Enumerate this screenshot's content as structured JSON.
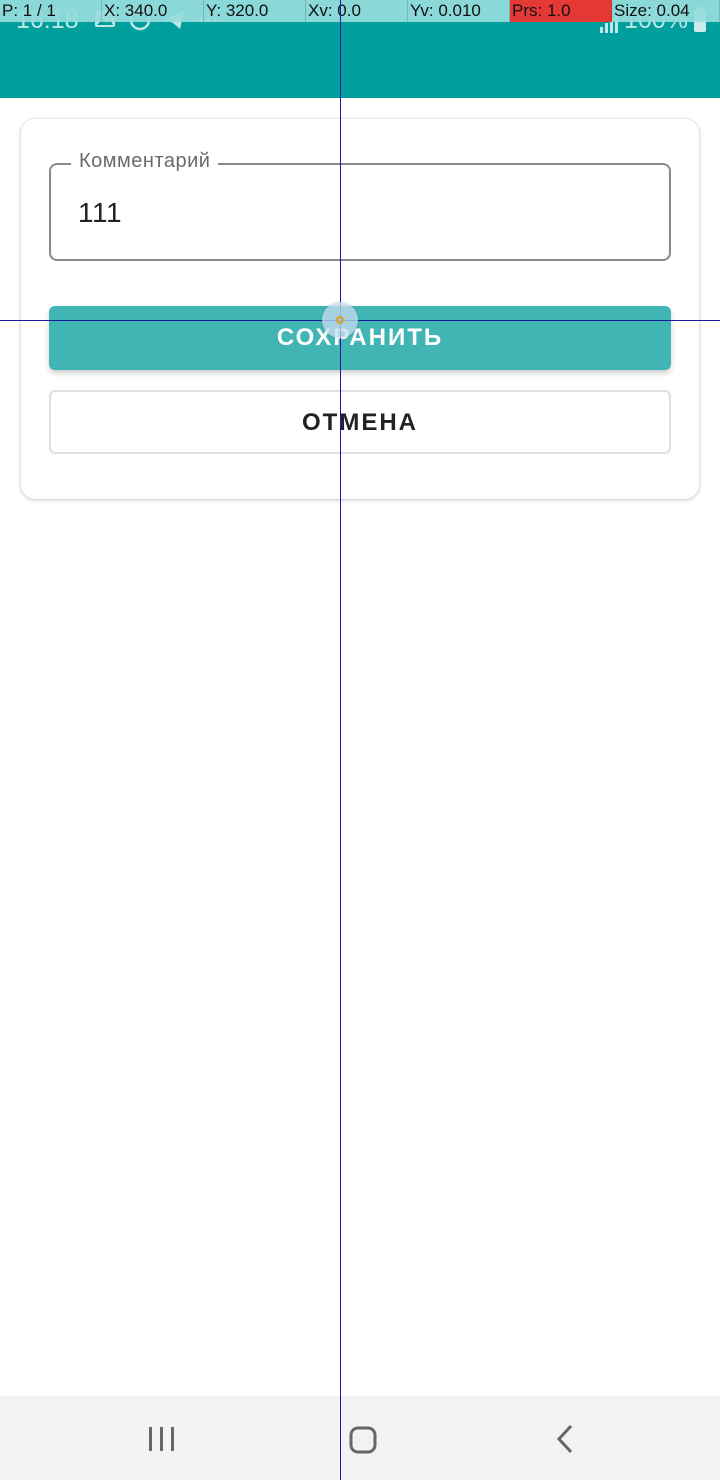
{
  "debug_overlay": {
    "pointer": "P: 1 / 1",
    "x": "X: 340.0",
    "y": "Y: 320.0",
    "xv": "Xv: 0.0",
    "yv": "Yv: 0.010",
    "prs": "Prs: 1.0",
    "size": "Size: 0.04"
  },
  "status_bar": {
    "time": "16:18",
    "battery": "100%",
    "icons": [
      "gallery-icon",
      "whatsapp-icon",
      "telegram-icon",
      "more-dots-icon",
      "wifi-icon",
      "signal-icon",
      "battery-icon"
    ]
  },
  "form": {
    "comment_label": "Комментарий",
    "comment_value": "111",
    "save_label": "СОХРАНИТЬ",
    "cancel_label": "ОТМЕНА"
  },
  "colors": {
    "app_bar": "#009f9d",
    "save_button": "#40b5b3",
    "debug_alert": "#e53935"
  },
  "nav_bar": {
    "icons": [
      "recent-apps-icon",
      "home-icon",
      "back-icon"
    ]
  }
}
